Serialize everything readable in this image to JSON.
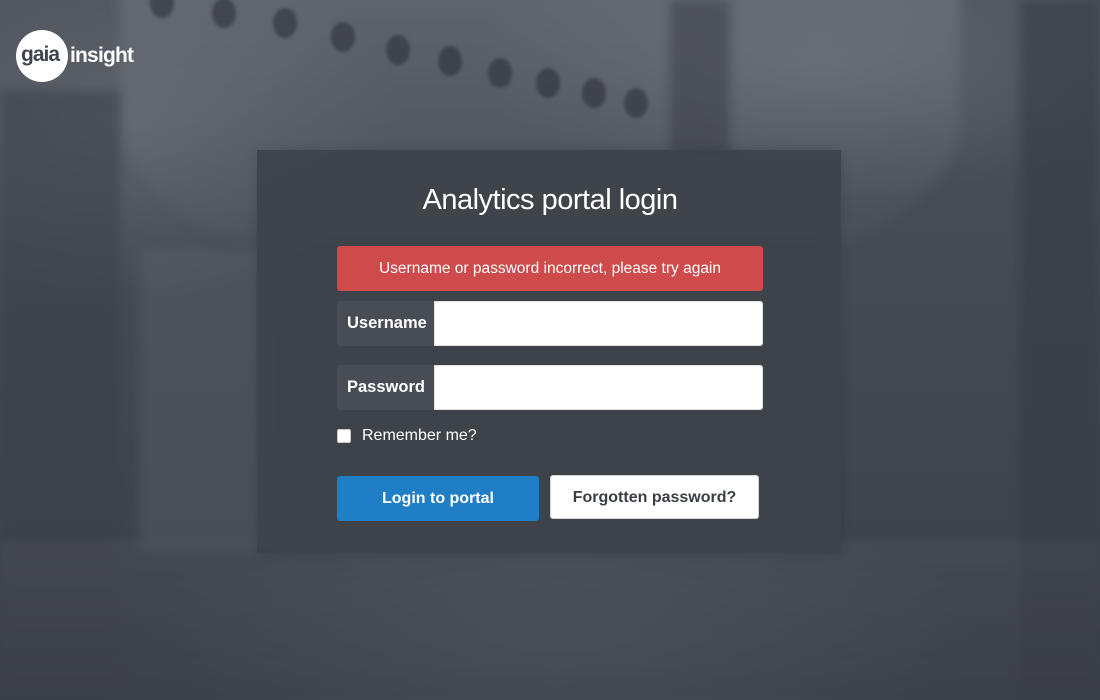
{
  "logo": {
    "brand_primary": "gaia",
    "brand_secondary": "insight"
  },
  "login": {
    "title": "Analytics portal login",
    "error_message": "Username or password incorrect, please try again",
    "username_label": "Username",
    "username_value": "",
    "password_label": "Password",
    "password_value": "",
    "remember_label": "Remember me?",
    "remember_checked": false,
    "login_button": "Login to portal",
    "forgot_button": "Forgotten password?"
  },
  "colors": {
    "error": "#cf4a4a",
    "primary_button": "#1f7ec6",
    "card_background": "#3e4249",
    "addon_background": "#474c55"
  }
}
